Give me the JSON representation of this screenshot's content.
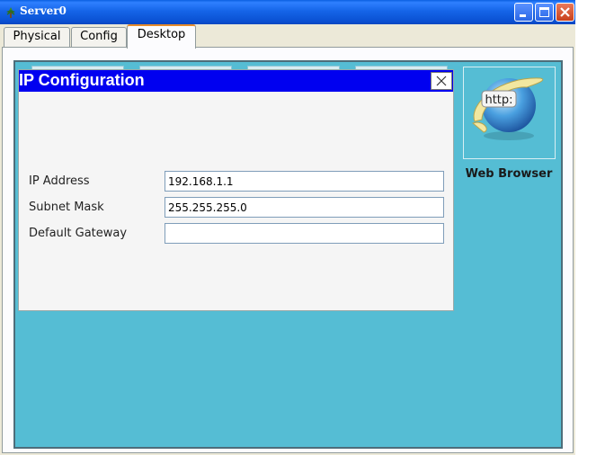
{
  "window": {
    "title": "Server0"
  },
  "tabs": [
    {
      "label": "Physical"
    },
    {
      "label": "Config"
    },
    {
      "label": "Desktop"
    }
  ],
  "desktop": {
    "web_browser": {
      "icon": "http-globe-icon",
      "badge": "http:",
      "label": "Web Browser"
    }
  },
  "ip_dialog": {
    "title": "IP Configuration",
    "fields": [
      {
        "label": "IP Address",
        "value": "192.168.1.1",
        "placeholder": ""
      },
      {
        "label": "Subnet Mask",
        "value": "255.255.255.0",
        "placeholder": ""
      },
      {
        "label": "Default Gateway",
        "value": "",
        "placeholder": ""
      }
    ]
  },
  "colors": {
    "titlebar": "#1565e8",
    "desktop_bg": "#55bdd4",
    "dialog_title": "#0000f0",
    "active_tab_accent": "#e68b2c"
  }
}
